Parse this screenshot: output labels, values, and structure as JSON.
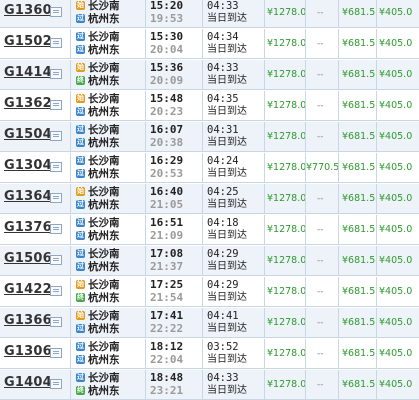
{
  "rows": [
    {
      "train": "G1360",
      "from_tag": "始",
      "from_tag_type": "shi",
      "from": "长沙南",
      "to_tag": "过",
      "to_tag_type": "guo",
      "to": "杭州东",
      "dep": "15:20",
      "arr": "19:53",
      "dur": "04:33",
      "same_day": "当日到达",
      "p1": "¥1278.0",
      "p2": "--",
      "p3": "¥681.5",
      "p4": "¥405.0"
    },
    {
      "train": "G1502",
      "from_tag": "过",
      "from_tag_type": "guo",
      "from": "长沙南",
      "to_tag": "过",
      "to_tag_type": "guo",
      "to": "杭州东",
      "dep": "15:30",
      "arr": "20:04",
      "dur": "04:34",
      "same_day": "当日到达",
      "p1": "¥1278.0",
      "p2": "--",
      "p3": "¥681.5",
      "p4": "¥405.0"
    },
    {
      "train": "G1414",
      "from_tag": "始",
      "from_tag_type": "shi",
      "from": "长沙南",
      "to_tag": "终",
      "to_tag_type": "zhong",
      "to": "杭州东",
      "dep": "15:36",
      "arr": "20:09",
      "dur": "04:33",
      "same_day": "当日到达",
      "p1": "¥1278.0",
      "p2": "--",
      "p3": "¥681.5",
      "p4": "¥405.0"
    },
    {
      "train": "G1362",
      "from_tag": "始",
      "from_tag_type": "shi",
      "from": "长沙南",
      "to_tag": "过",
      "to_tag_type": "guo",
      "to": "杭州东",
      "dep": "15:48",
      "arr": "20:23",
      "dur": "04:35",
      "same_day": "当日到达",
      "p1": "¥1278.0",
      "p2": "--",
      "p3": "¥681.5",
      "p4": "¥405.0"
    },
    {
      "train": "G1504",
      "from_tag": "过",
      "from_tag_type": "guo",
      "from": "长沙南",
      "to_tag": "过",
      "to_tag_type": "guo",
      "to": "杭州东",
      "dep": "16:07",
      "arr": "20:38",
      "dur": "04:31",
      "same_day": "当日到达",
      "p1": "¥1278.0",
      "p2": "--",
      "p3": "¥681.5",
      "p4": "¥405.0"
    },
    {
      "train": "G1304",
      "from_tag": "过",
      "from_tag_type": "guo",
      "from": "长沙南",
      "to_tag": "过",
      "to_tag_type": "guo",
      "to": "杭州东",
      "dep": "16:29",
      "arr": "20:53",
      "dur": "04:24",
      "same_day": "当日到达",
      "p1": "¥1278.0",
      "p2": "¥770.5",
      "p3": "¥681.5",
      "p4": "¥405.0"
    },
    {
      "train": "G1364",
      "from_tag": "始",
      "from_tag_type": "shi",
      "from": "长沙南",
      "to_tag": "过",
      "to_tag_type": "guo",
      "to": "杭州东",
      "dep": "16:40",
      "arr": "21:05",
      "dur": "04:25",
      "same_day": "当日到达",
      "p1": "¥1278.0",
      "p2": "--",
      "p3": "¥681.5",
      "p4": "¥405.0"
    },
    {
      "train": "G1376",
      "from_tag": "过",
      "from_tag_type": "guo",
      "from": "长沙南",
      "to_tag": "过",
      "to_tag_type": "guo",
      "to": "杭州东",
      "dep": "16:51",
      "arr": "21:09",
      "dur": "04:18",
      "same_day": "当日到达",
      "p1": "¥1278.0",
      "p2": "--",
      "p3": "¥681.5",
      "p4": "¥405.0"
    },
    {
      "train": "G1506",
      "from_tag": "过",
      "from_tag_type": "guo",
      "from": "长沙南",
      "to_tag": "过",
      "to_tag_type": "guo",
      "to": "杭州东",
      "dep": "17:08",
      "arr": "21:37",
      "dur": "04:29",
      "same_day": "当日到达",
      "p1": "¥1278.0",
      "p2": "--",
      "p3": "¥681.5",
      "p4": "¥405.0"
    },
    {
      "train": "G1422",
      "from_tag": "始",
      "from_tag_type": "shi",
      "from": "长沙南",
      "to_tag": "终",
      "to_tag_type": "zhong",
      "to": "杭州东",
      "dep": "17:25",
      "arr": "21:54",
      "dur": "04:29",
      "same_day": "当日到达",
      "p1": "¥1278.0",
      "p2": "--",
      "p3": "¥681.5",
      "p4": "¥405.0"
    },
    {
      "train": "G1366",
      "from_tag": "始",
      "from_tag_type": "shi",
      "from": "长沙南",
      "to_tag": "过",
      "to_tag_type": "guo",
      "to": "杭州东",
      "dep": "17:41",
      "arr": "22:22",
      "dur": "04:41",
      "same_day": "当日到达",
      "p1": "¥1278.0",
      "p2": "--",
      "p3": "¥681.5",
      "p4": "¥405.0"
    },
    {
      "train": "G1306",
      "from_tag": "过",
      "from_tag_type": "guo",
      "from": "长沙南",
      "to_tag": "过",
      "to_tag_type": "guo",
      "to": "杭州东",
      "dep": "18:12",
      "arr": "22:04",
      "dur": "03:52",
      "same_day": "当日到达",
      "p1": "¥1278.0",
      "p2": "--",
      "p3": "¥681.5",
      "p4": "¥405.0"
    },
    {
      "train": "G1404",
      "from_tag": "过",
      "from_tag_type": "guo",
      "from": "长沙南",
      "to_tag": "终",
      "to_tag_type": "zhong",
      "to": "杭州东",
      "dep": "18:48",
      "arr": "23:21",
      "dur": "04:33",
      "same_day": "当日到达",
      "p1": "¥1278.0",
      "p2": "--",
      "p3": "¥681.5",
      "p4": "¥405.0"
    }
  ],
  "detail_icon": "list-icon",
  "colors": {
    "price": "#2e9a2e",
    "border": "#c9d6e6",
    "alt_row": "#eef3fa",
    "tag_shi": "#e59a1a",
    "tag_guo": "#3a86cc",
    "tag_zhong": "#4aa64a"
  }
}
